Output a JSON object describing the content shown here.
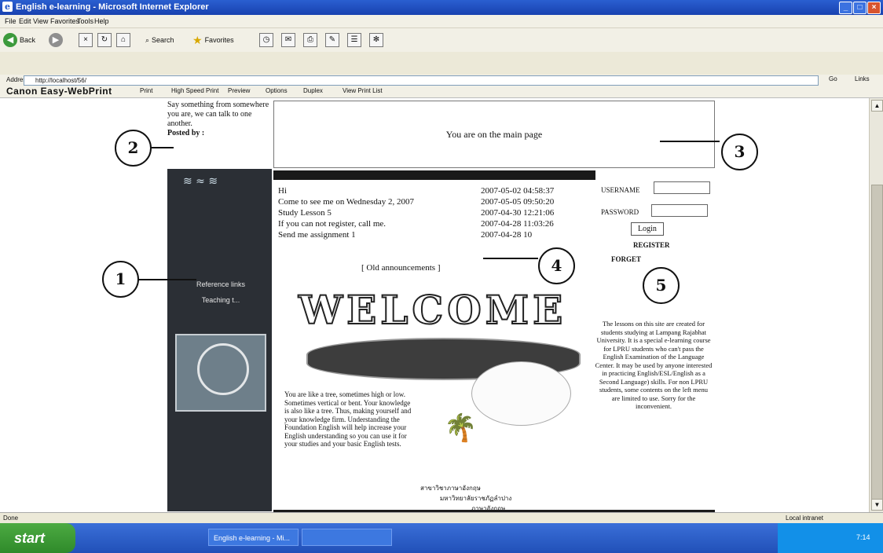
{
  "window": {
    "title": "English e-learning - Microsoft Internet Explorer"
  },
  "menu": [
    "File",
    "Edit",
    "View",
    "Favorites",
    "Tools",
    "Help"
  ],
  "toolbar": {
    "back": "Back",
    "search": "Search",
    "favorites": "Favorites"
  },
  "address": {
    "label": "Address",
    "url": "http://localhost/56/",
    "go": "Go",
    "links": "Links"
  },
  "canon": {
    "brand": "Canon Easy-WebPrint",
    "print": "Print",
    "high_speed": "High Speed Print",
    "preview": "Preview",
    "options": "Options",
    "duplex": "Duplex",
    "view_print_list": "View Print List"
  },
  "page": {
    "say_text": "Say something from somewhere you are, we can talk to one another.",
    "posted_by": "Posted by :",
    "main_box": "You are on the main page",
    "nav": [
      "Reference links",
      "Teaching t..."
    ],
    "announcements": [
      {
        "text": "Hi",
        "date": "2007-05-02 04:58:37"
      },
      {
        "text": "Come to see me on Wednesday 2, 2007",
        "date": "2007-05-05 09:50:20"
      },
      {
        "text": "Study Lesson 5",
        "date": "2007-04-30 12:21:06"
      },
      {
        "text": "If you can not register, call me.",
        "date": "2007-04-28 11:03:26"
      },
      {
        "text": "Send me assignment 1",
        "date": "2007-04-28 10"
      }
    ],
    "old_announcements": "[ Old announcements ]",
    "username_label": "USERNAME",
    "password_label": "PASSWORD",
    "login_button": "Login",
    "register": "REGISTER",
    "forget": "FORGET",
    "welcome": "WELCOME",
    "tree_text": "You are like a tree, sometimes high or low. Sometimes vertical or bent. Your knowledge is also like a tree. Thus, making yourself and your knowledge firm. Understanding the Foundation English will help increase your English understanding so you can use it for your studies and your basic English tests.",
    "right_info": "The lessons on this site are created for students studying at Lampang Rajabhat University. It is a special e-learning course for LPRU students who can't pass the English Examination of the Language Center. It may be used by anyone interested in practicing English/ESL/English as a Second Language) skills. For non LPRU students, some contents on the left menu are limited to use. Sorry for the inconvenient.",
    "thai_line1": "สาขาวิชาภาษาอังกฤษ",
    "thai_line2": "มหาวิทยาลัยราชภัฏลำปาง",
    "thai_line3": "ภาษาอังกฤษ"
  },
  "callouts": [
    "1",
    "2",
    "3",
    "4",
    "5"
  ],
  "status": {
    "left": "Done",
    "right": "Local intranet"
  },
  "taskbar": {
    "start": "start",
    "task1": "English e-learning - Mi...",
    "task2": "",
    "clock": "7:14"
  }
}
